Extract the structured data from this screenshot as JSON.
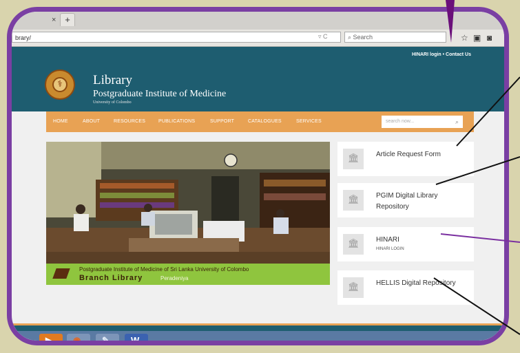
{
  "browser": {
    "tab_close": "×",
    "tab_new": "+",
    "url": "brary/",
    "search_placeholder": "Search",
    "url_controls": "▿ C"
  },
  "site": {
    "toplinks": "HINARI login  •  Contact Us",
    "title": "Library",
    "subtitle": "Postgraduate Institute of Medicine",
    "university": "University of Colombo",
    "menu": [
      "HOME",
      "ABOUT",
      "RESOURCES",
      "PUBLICATIONS",
      "SUPPORT",
      "CATALOGUES",
      "SERVICES"
    ],
    "search_placeholder": "search now..."
  },
  "hero": {
    "caption_line1": "Postgraduate Institute of Medicine of Sri Lanka University of Colombo",
    "caption_line2": "Branch Library",
    "caption_place": "Peradeniya"
  },
  "cards": [
    {
      "title": "Article Request Form",
      "sub": ""
    },
    {
      "title": "PGIM Digital Library Repository",
      "sub": ""
    },
    {
      "title": "HINARI",
      "sub": "HINARI LOGIN"
    },
    {
      "title": "HELLIS Digital Repository",
      "sub": ""
    }
  ],
  "taskbar": {
    "word_label": "W"
  },
  "colors": {
    "header": "#1e5d70",
    "menu": "#e8a254",
    "frame": "#7a3fa3",
    "caption": "#8fc53e"
  }
}
